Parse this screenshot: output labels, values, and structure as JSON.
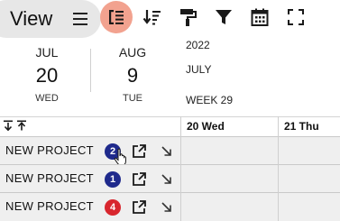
{
  "toolbar": {
    "view_label": "View",
    "icons": [
      "menu-icon",
      "outline-levels-icon",
      "sort-icon",
      "format-paint-icon",
      "filter-icon",
      "calendar-icon",
      "fullscreen-icon"
    ],
    "active_icon": "outline-levels-icon",
    "active_color": "#f2a28f"
  },
  "dates": [
    {
      "month": "JUL",
      "day": "20",
      "weekday": "WED"
    },
    {
      "month": "AUG",
      "day": "9",
      "weekday": "TUE"
    }
  ],
  "info": {
    "year": "2022",
    "month": "JULY",
    "week": "WEEK 29"
  },
  "grid": {
    "columns": [
      "20 Wed",
      "21 Thu"
    ],
    "rows": [
      {
        "name": "NEW PROJECT",
        "badge": "2",
        "badge_color": "#1f2a8c"
      },
      {
        "name": "NEW PROJECT",
        "badge": "1",
        "badge_color": "#1f2a8c"
      },
      {
        "name": "NEW PROJECT",
        "badge": "4",
        "badge_color": "#d8262e"
      }
    ]
  }
}
